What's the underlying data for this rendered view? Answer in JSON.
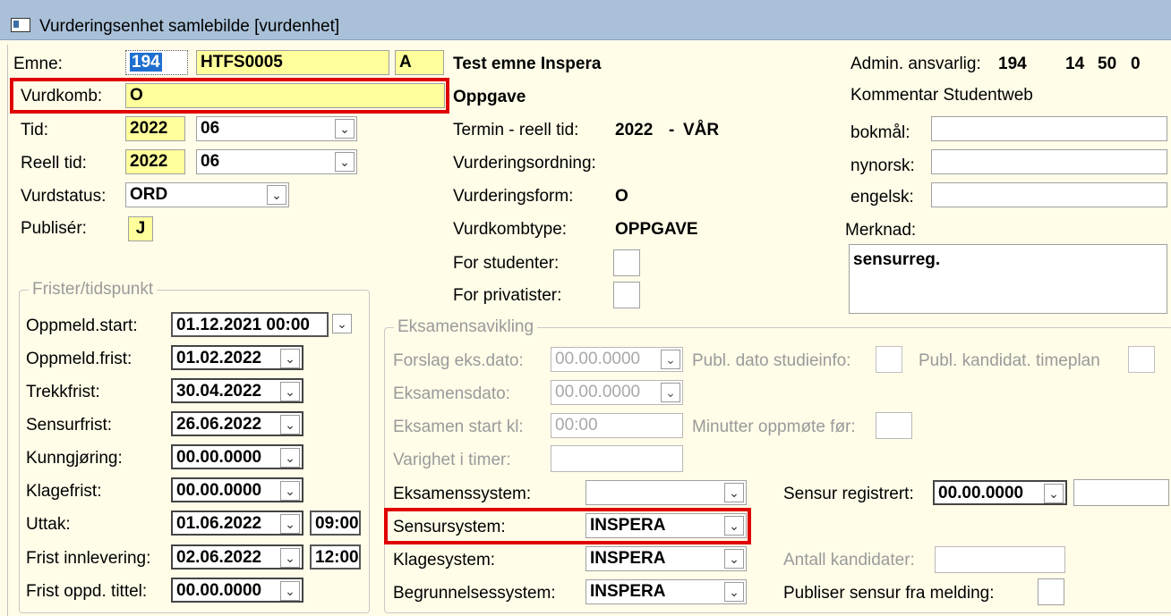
{
  "window": {
    "title": "Vurderingsenhet samlebilde [vurdenhet]"
  },
  "left": {
    "emne_label": "Emne:",
    "emne_code": "194",
    "emne_id": "HTFS0005",
    "emne_ver": "A",
    "vurdkomb_label": "Vurdkomb:",
    "vurdkomb_value": "O",
    "tid_label": "Tid:",
    "tid_year": "2022",
    "tid_month": "06",
    "reell_label": "Reell tid:",
    "reell_year": "2022",
    "reell_month": "06",
    "vurdstatus_label": "Vurdstatus:",
    "vurdstatus_value": "ORD",
    "publiser_label": "Publisér:",
    "publiser_value": "J"
  },
  "middle": {
    "emne_name": "Test emne Inspera",
    "vurdkomb_name": "Oppgave",
    "termin_label": "Termin - reell tid:",
    "termin_year": "2022",
    "termin_sep": "-",
    "termin_sem": "VÅR",
    "ordning_label": "Vurderingsordning:",
    "form_label": "Vurderingsform:",
    "form_value": "O",
    "type_label": "Vurdkombtype:",
    "type_value": "OPPGAVE",
    "for_studenter_label": "For studenter:",
    "for_privatister_label": "For privatister:"
  },
  "right": {
    "admin_label": "Admin. ansvarlig:",
    "admin_1": "194",
    "admin_2": "14",
    "admin_3": "50",
    "admin_4": "0",
    "kommentar_label": "Kommentar Studentweb",
    "bokmal_label": "bokmål:",
    "nynorsk_label": "nynorsk:",
    "engelsk_label": "engelsk:",
    "merknad_label": "Merknad:",
    "merknad_value": "sensurreg."
  },
  "frister": {
    "group_label": "Frister/tidspunkt",
    "rows": [
      {
        "label": "Oppmeld.start:",
        "value": "01.12.2021 00:00"
      },
      {
        "label": "Oppmeld.frist:",
        "value": "01.02.2022"
      },
      {
        "label": "Trekkfrist:",
        "value": "30.04.2022"
      },
      {
        "label": "Sensurfrist:",
        "value": "26.06.2022"
      },
      {
        "label": "Kunngjøring:",
        "value": "00.00.0000"
      },
      {
        "label": "Klagefrist:",
        "value": "00.00.0000"
      },
      {
        "label": "Uttak:",
        "value": "01.06.2022",
        "time": "09:00"
      },
      {
        "label": "Frist innlevering:",
        "value": "02.06.2022",
        "time": "12:00"
      },
      {
        "label": "Frist oppd. tittel:",
        "value": "00.00.0000"
      }
    ]
  },
  "eksamen": {
    "group_label": "Eksamensavikling",
    "forslag_label": "Forslag eks.dato:",
    "forslag_value": "00.00.0000",
    "publ_dato_label": "Publ. dato studieinfo:",
    "publ_kand_label": "Publ. kandidat. timeplan",
    "eksamensdato_label": "Eksamensdato:",
    "eksamensdato_value": "00.00.0000",
    "start_label": "Eksamen start kl:",
    "start_value": "00:00",
    "minutter_label": "Minutter oppmøte før:",
    "varighet_label": "Varighet i timer:",
    "eksamenssystem_label": "Eksamenssystem:",
    "eksamenssystem_value": "",
    "sensur_reg_label": "Sensur registrert:",
    "sensur_reg_value": "00.00.0000",
    "sensursystem_label": "Sensursystem:",
    "sensursystem_value": "INSPERA",
    "klagesystem_label": "Klagesystem:",
    "klagesystem_value": "INSPERA",
    "antall_label": "Antall kandidater:",
    "begrunnelse_label": "Begrunnelsessystem:",
    "begrunnelse_value": "INSPERA",
    "publiser_sensur_label": "Publiser sensur fra melding:"
  },
  "icons": {
    "dropdown": "chevron-down-icon",
    "window": "window-icon"
  },
  "colors": {
    "field_required": "#ffff9c",
    "highlight": "#e00000",
    "background": "#fffce8",
    "titlebar": "#a9c0d8"
  }
}
